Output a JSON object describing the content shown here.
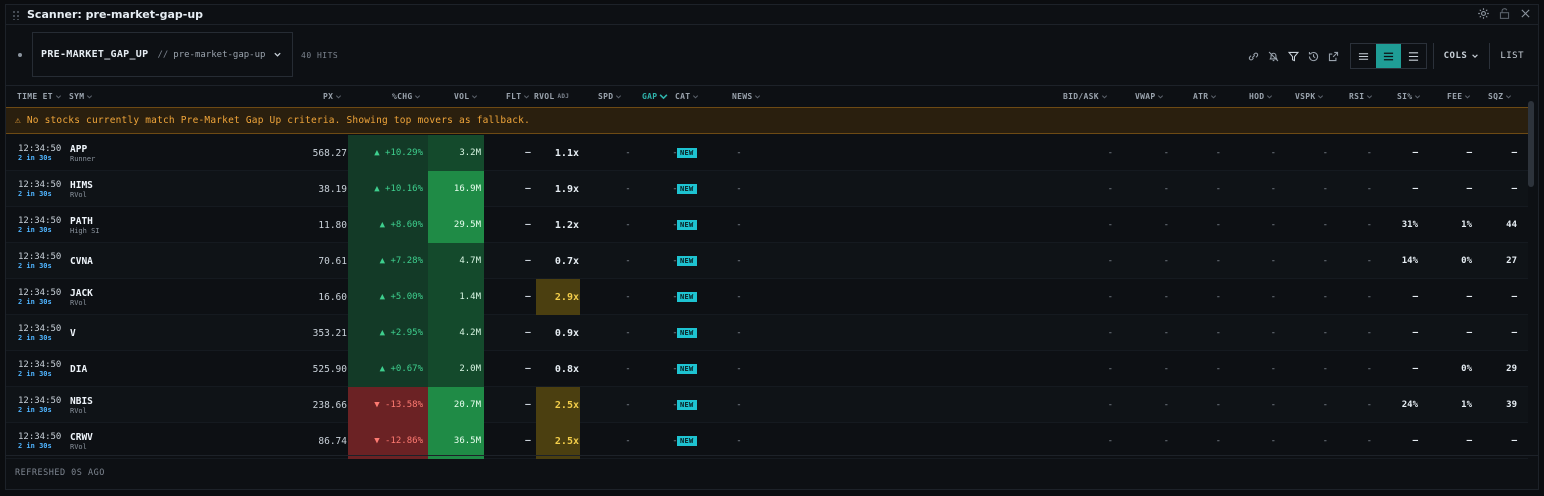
{
  "window": {
    "title": "Scanner: pre-market-gap-up"
  },
  "toolbar": {
    "preset_name": "PRE-MARKET_GAP_UP",
    "preset_separator": "//",
    "preset_slug": "pre-market-gap-up",
    "hits": "40 HITS",
    "cols_label": "COLS",
    "list_label": "LIST"
  },
  "columns": {
    "time": "TIME ET",
    "sym": "SYM",
    "px": "PX",
    "chg": "%CHG",
    "vol": "VOL",
    "flt": "FLT",
    "rvol": "RVOL",
    "rvol_sub": "ADJ",
    "spd": "SPD",
    "gap": "GAP",
    "cat": "CAT",
    "news": "NEWS",
    "bidask": "BID/ASK",
    "vwap": "VWAP",
    "atr": "ATR",
    "hod": "HOD",
    "vspk": "VSPK",
    "rsi": "RSI",
    "si": "SI%",
    "fee": "FEE",
    "sqz": "SQZ"
  },
  "banner": "⚠ No stocks currently match Pre-Market Gap Up criteria. Showing top movers as fallback.",
  "rows": [
    {
      "time": "12:34:50",
      "rel": "2 in 30s",
      "sym": "APP",
      "tag": "Runner",
      "px": "568.27",
      "chg": "▲ +10.29%",
      "dir": "up",
      "vol": "3.2M",
      "vol_shade": "dark",
      "flt": "—",
      "rvol": "1.1x",
      "rvol_hl": false,
      "spd": "-",
      "gap": "-",
      "cat": "NEW",
      "news": "-",
      "bidask": "-",
      "vwap": "-",
      "atr": "-",
      "hod": "-",
      "vspk": "-",
      "rsi": "-",
      "si": "—",
      "fee": "—",
      "sqz": "—"
    },
    {
      "time": "12:34:50",
      "rel": "2 in 30s",
      "sym": "HIMS",
      "tag": "RVol",
      "px": "38.19",
      "chg": "▲ +10.16%",
      "dir": "up",
      "vol": "16.9M",
      "vol_shade": "light",
      "flt": "—",
      "rvol": "1.9x",
      "rvol_hl": false,
      "spd": "-",
      "gap": "-",
      "cat": "NEW",
      "news": "-",
      "bidask": "-",
      "vwap": "-",
      "atr": "-",
      "hod": "-",
      "vspk": "-",
      "rsi": "-",
      "si": "—",
      "fee": "—",
      "sqz": "—"
    },
    {
      "time": "12:34:50",
      "rel": "2 in 30s",
      "sym": "PATH",
      "tag": "High SI",
      "px": "11.80",
      "chg": "▲ +8.60%",
      "dir": "up",
      "vol": "29.5M",
      "vol_shade": "light",
      "flt": "—",
      "rvol": "1.2x",
      "rvol_hl": false,
      "spd": "-",
      "gap": "-",
      "cat": "NEW",
      "news": "-",
      "bidask": "-",
      "vwap": "-",
      "atr": "-",
      "hod": "-",
      "vspk": "-",
      "rsi": "-",
      "si": "31%",
      "fee": "1%",
      "sqz": "44"
    },
    {
      "time": "12:34:50",
      "rel": "2 in 30s",
      "sym": "CVNA",
      "tag": "",
      "px": "70.61",
      "chg": "▲ +7.28%",
      "dir": "up",
      "vol": "4.7M",
      "vol_shade": "dark",
      "flt": "—",
      "rvol": "0.7x",
      "rvol_hl": false,
      "spd": "-",
      "gap": "-",
      "cat": "NEW",
      "news": "-",
      "bidask": "-",
      "vwap": "-",
      "atr": "-",
      "hod": "-",
      "vspk": "-",
      "rsi": "-",
      "si": "14%",
      "fee": "0%",
      "sqz": "27"
    },
    {
      "time": "12:34:50",
      "rel": "2 in 30s",
      "sym": "JACK",
      "tag": "RVol",
      "px": "16.60",
      "chg": "▲ +5.00%",
      "dir": "up",
      "vol": "1.4M",
      "vol_shade": "dark",
      "flt": "—",
      "rvol": "2.9x",
      "rvol_hl": true,
      "spd": "-",
      "gap": "-",
      "cat": "NEW",
      "news": "-",
      "bidask": "-",
      "vwap": "-",
      "atr": "-",
      "hod": "-",
      "vspk": "-",
      "rsi": "-",
      "si": "—",
      "fee": "—",
      "sqz": "—"
    },
    {
      "time": "12:34:50",
      "rel": "2 in 30s",
      "sym": "V",
      "tag": "",
      "px": "353.21",
      "chg": "▲ +2.95%",
      "dir": "up",
      "vol": "4.2M",
      "vol_shade": "dark",
      "flt": "—",
      "rvol": "0.9x",
      "rvol_hl": false,
      "spd": "-",
      "gap": "-",
      "cat": "NEW",
      "news": "-",
      "bidask": "-",
      "vwap": "-",
      "atr": "-",
      "hod": "-",
      "vspk": "-",
      "rsi": "-",
      "si": "—",
      "fee": "—",
      "sqz": "—"
    },
    {
      "time": "12:34:50",
      "rel": "2 in 30s",
      "sym": "DIA",
      "tag": "",
      "px": "525.90",
      "chg": "▲ +0.67%",
      "dir": "up",
      "vol": "2.0M",
      "vol_shade": "dark",
      "flt": "—",
      "rvol": "0.8x",
      "rvol_hl": false,
      "spd": "-",
      "gap": "-",
      "cat": "NEW",
      "news": "-",
      "bidask": "-",
      "vwap": "-",
      "atr": "-",
      "hod": "-",
      "vspk": "-",
      "rsi": "-",
      "si": "—",
      "fee": "0%",
      "sqz": "29"
    },
    {
      "time": "12:34:50",
      "rel": "2 in 30s",
      "sym": "NBIS",
      "tag": "RVol",
      "px": "238.66",
      "chg": "▼ -13.58%",
      "dir": "down",
      "vol": "20.7M",
      "vol_shade": "light",
      "flt": "—",
      "rvol": "2.5x",
      "rvol_hl": true,
      "spd": "-",
      "gap": "-",
      "cat": "NEW",
      "news": "-",
      "bidask": "-",
      "vwap": "-",
      "atr": "-",
      "hod": "-",
      "vspk": "-",
      "rsi": "-",
      "si": "24%",
      "fee": "1%",
      "sqz": "39"
    },
    {
      "time": "12:34:50",
      "rel": "2 in 30s",
      "sym": "CRWV",
      "tag": "RVol",
      "px": "86.74",
      "chg": "▼ -12.86%",
      "dir": "down",
      "vol": "36.5M",
      "vol_shade": "light",
      "flt": "—",
      "rvol": "2.5x",
      "rvol_hl": true,
      "spd": "-",
      "gap": "-",
      "cat": "NEW",
      "news": "-",
      "bidask": "-",
      "vwap": "-",
      "atr": "-",
      "hod": "-",
      "vspk": "-",
      "rsi": "-",
      "si": "—",
      "fee": "—",
      "sqz": "—"
    }
  ],
  "footer": {
    "refreshed": "REFRESHED 0S AGO"
  },
  "colors": {
    "accent": "#1f9d96",
    "up": "#3ecf8e",
    "down": "#ff7b72",
    "warning": "#f0a53a",
    "badge": "#1ec3d1"
  }
}
